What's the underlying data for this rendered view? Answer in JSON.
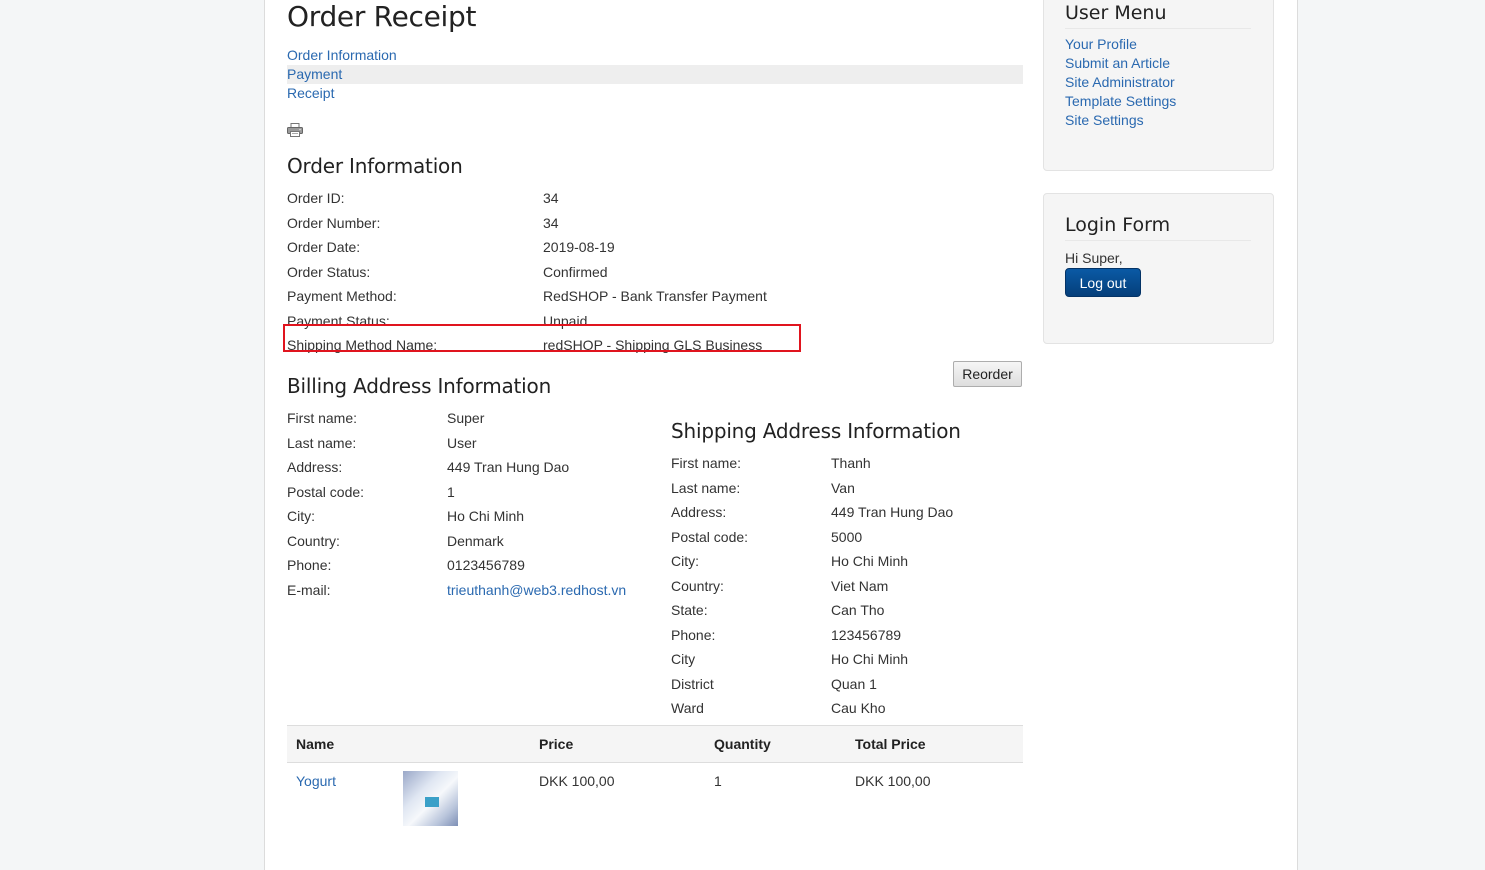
{
  "title": "Order Receipt",
  "steps": [
    "Order Information",
    "Payment",
    "Receipt"
  ],
  "active_step": "Payment",
  "print_icon": "printer-icon",
  "order_info": {
    "heading": "Order Information",
    "rows": [
      {
        "label": "Order ID:",
        "value": "34"
      },
      {
        "label": "Order Number:",
        "value": "34"
      },
      {
        "label": "Order Date:",
        "value": "2019-08-19"
      },
      {
        "label": "Order Status:",
        "value": "Confirmed"
      },
      {
        "label": "Payment Method:",
        "value": "RedSHOP - Bank Transfer Payment"
      },
      {
        "label": "Payment Status:",
        "value": "Unpaid"
      },
      {
        "label": "Shipping Method Name:",
        "value": "redSHOP - Shipping GLS Business"
      }
    ]
  },
  "reorder_label": "Reorder",
  "billing": {
    "heading": "Billing Address Information",
    "rows": [
      {
        "label": "First name:",
        "value": "Super"
      },
      {
        "label": "Last name:",
        "value": "User"
      },
      {
        "label": "Address:",
        "value": "449 Tran Hung Dao"
      },
      {
        "label": "Postal code:",
        "value": "1"
      },
      {
        "label": "City:",
        "value": "Ho Chi Minh"
      },
      {
        "label": "Country:",
        "value": "Denmark"
      },
      {
        "label": "Phone:",
        "value": "0123456789"
      },
      {
        "label": "E-mail:",
        "value": "trieuthanh@web3.redhost.vn"
      }
    ]
  },
  "shipping": {
    "heading": "Shipping Address Information",
    "rows": [
      {
        "label": "First name:",
        "value": "Thanh"
      },
      {
        "label": "Last name:",
        "value": "Van"
      },
      {
        "label": "Address:",
        "value": "449 Tran Hung Dao"
      },
      {
        "label": "Postal code:",
        "value": "5000"
      },
      {
        "label": "City:",
        "value": "Ho Chi Minh"
      },
      {
        "label": "Country:",
        "value": "Viet Nam"
      },
      {
        "label": "State:",
        "value": "Can Tho"
      },
      {
        "label": "Phone:",
        "value": "123456789"
      },
      {
        "label": "City",
        "value": "Ho Chi Minh"
      },
      {
        "label": "District",
        "value": "Quan 1"
      },
      {
        "label": "Ward",
        "value": "Cau Kho"
      }
    ]
  },
  "items_table": {
    "headers": [
      "Name",
      "",
      "Price",
      "Quantity",
      "Total Price"
    ],
    "rows": [
      {
        "name": "Yogurt",
        "price": "DKK 100,00",
        "quantity": "1",
        "total": "DKK 100,00"
      }
    ]
  },
  "user_menu": {
    "heading": "User Menu",
    "items": [
      "Your Profile",
      "Submit an Article",
      "Site Administrator",
      "Template Settings",
      "Site Settings"
    ]
  },
  "login_form": {
    "heading": "Login Form",
    "greeting": "Hi Super,",
    "logout_label": "Log out"
  },
  "colors": {
    "link": "#2a69b0",
    "highlight": "#e0141e",
    "logout_button": "#0a5aa5"
  }
}
